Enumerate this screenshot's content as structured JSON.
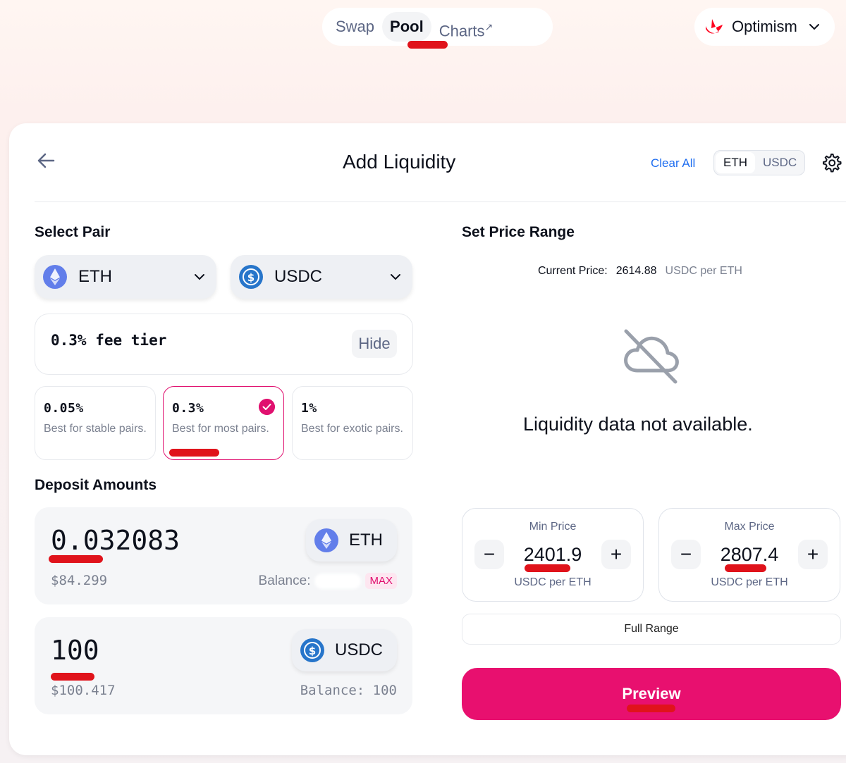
{
  "nav": {
    "tabs": [
      {
        "label": "Swap"
      },
      {
        "label": "Pool"
      },
      {
        "label": "Charts",
        "suffix": "↗"
      }
    ],
    "active_tab": "Pool",
    "network": {
      "label": "Optimism",
      "icon": "optimism-logo",
      "color": "#ff0420"
    }
  },
  "header": {
    "title": "Add Liquidity",
    "clear_all": "Clear All",
    "toggle": [
      "ETH",
      "USDC"
    ],
    "toggle_selected": "ETH"
  },
  "select_pair": {
    "label": "Select Pair",
    "token_a": {
      "symbol": "ETH",
      "icon": "eth-icon"
    },
    "token_b": {
      "symbol": "USDC",
      "icon": "usdc-icon"
    }
  },
  "fee": {
    "current": "0.3% fee tier",
    "hide_label": "Hide",
    "tiers": [
      {
        "pct": "0.05%",
        "desc": "Best for stable pairs."
      },
      {
        "pct": "0.3%",
        "desc": "Best for most pairs.",
        "selected": true
      },
      {
        "pct": "1%",
        "desc": "Best for exotic pairs."
      }
    ]
  },
  "deposit": {
    "label": "Deposit Amounts",
    "eth": {
      "amount": "0.032083",
      "usd": "$84.299",
      "symbol": "ETH",
      "balance_label": "Balance:",
      "max_label": "MAX"
    },
    "usdc": {
      "amount": "100",
      "usd": "$100.417",
      "symbol": "USDC",
      "balance": "Balance: 100"
    }
  },
  "price_range": {
    "label": "Set Price Range",
    "current_label": "Current Price:",
    "current_value": "2614.88",
    "current_unit": "USDC per ETH",
    "no_data": "Liquidity data not available.",
    "min": {
      "label": "Min Price",
      "value": "2401.9",
      "unit": "USDC per ETH"
    },
    "max": {
      "label": "Max Price",
      "value": "2807.4",
      "unit": "USDC per ETH"
    },
    "full_range": "Full Range",
    "preview": "Preview"
  },
  "colors": {
    "accent": "#e8106f",
    "link": "#1f6ef0",
    "annotation": "#e0131b"
  }
}
